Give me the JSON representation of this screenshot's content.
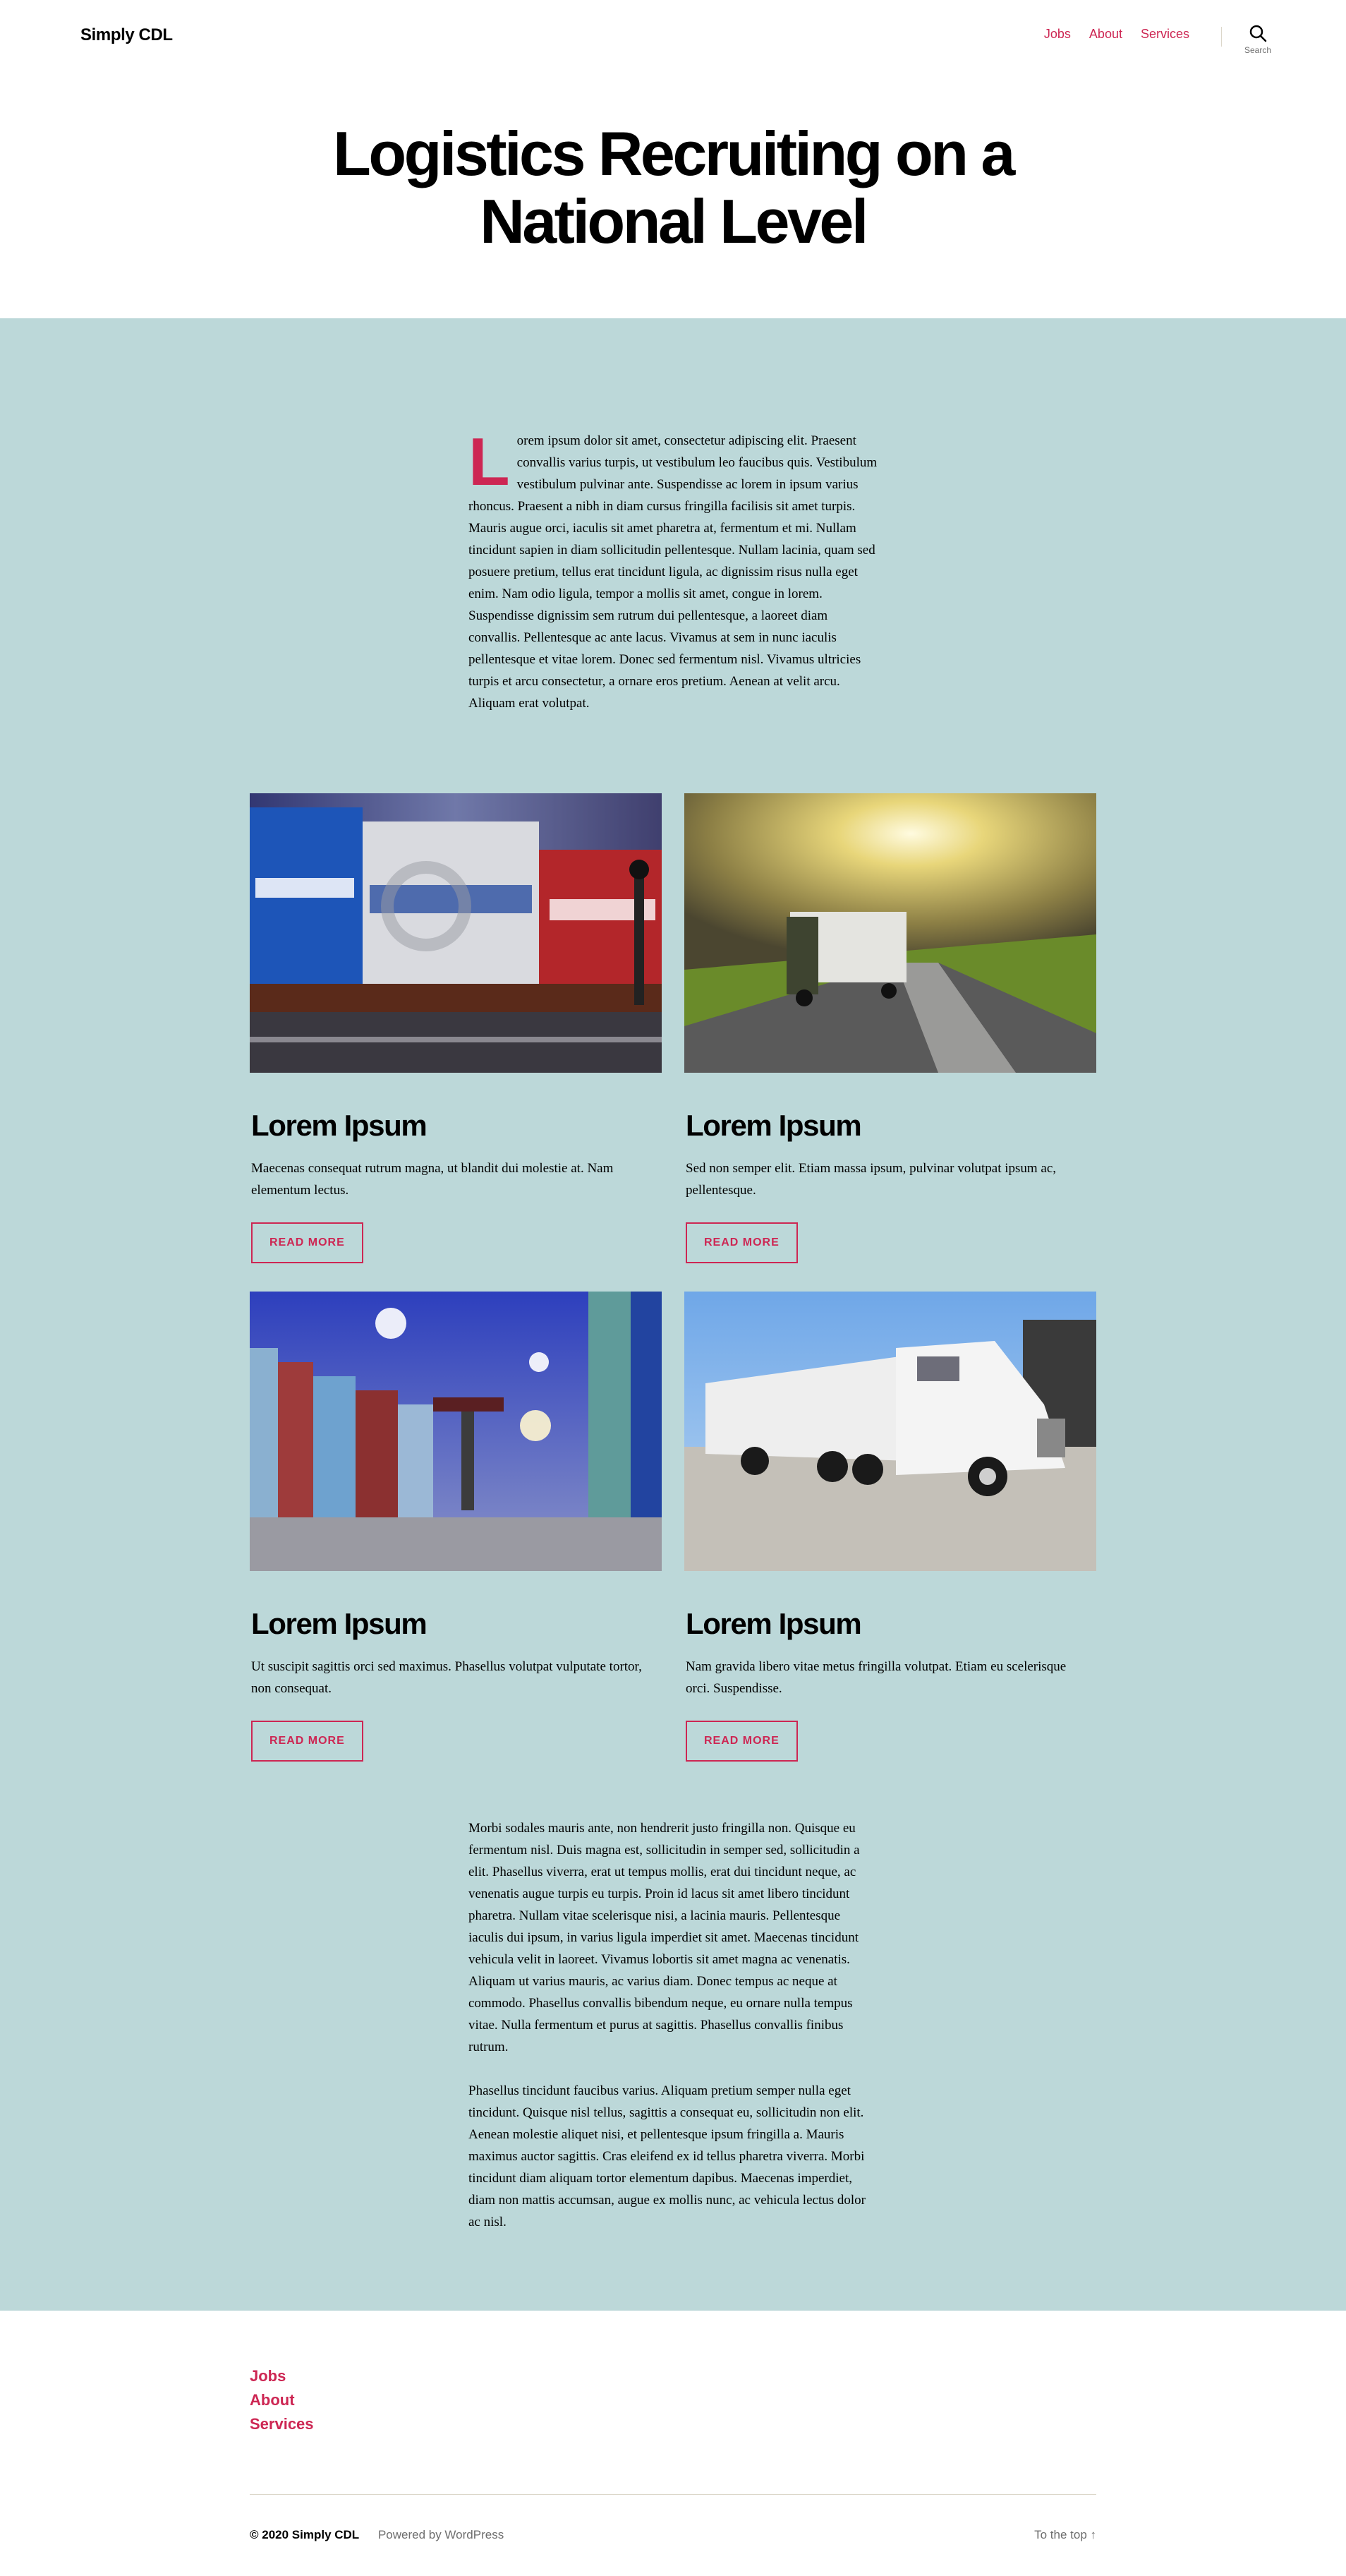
{
  "header": {
    "site_title": "Simply CDL",
    "nav": [
      {
        "label": "Jobs"
      },
      {
        "label": "About"
      },
      {
        "label": "Services"
      }
    ],
    "search_label": "Search",
    "search_icon": "search-icon"
  },
  "hero": {
    "title": "Logistics Recruiting on a National Level"
  },
  "intro": {
    "dropcap": "L",
    "text": "orem ipsum dolor sit amet, consectetur adipiscing elit. Praesent convallis varius turpis, ut vestibulum leo faucibus quis. Vestibulum vestibulum pulvinar ante. Suspendisse ac lorem in ipsum varius rhoncus. Praesent a nibh in diam cursus fringilla facilisis sit amet turpis. Mauris augue orci, iaculis sit amet pharetra at, fermentum et mi. Nullam tincidunt sapien in diam sollicitudin pellentesque. Nullam lacinia, quam sed posuere pretium, tellus erat tincidunt ligula, ac dignissim risus nulla eget enim. Nam odio ligula, tempor a mollis sit amet, congue in lorem. Suspendisse dignissim sem rutrum dui pellentesque, a laoreet diam convallis. Pellentesque ac ante lacus. Vivamus at sem in nunc iaculis pellentesque et vitae lorem. Donec sed fermentum nisl. Vivamus ultricies turpis et arcu consectetur, a ornare eros pretium. Aenean at velit arcu. Aliquam erat volutpat."
  },
  "cards": [
    {
      "title": "Lorem Ipsum",
      "text": "Maecenas consequat rutrum magna, ut blandit dui molestie at. Nam elementum lectus.",
      "button": "READ MORE"
    },
    {
      "title": "Lorem Ipsum",
      "text": "Sed non semper elit. Etiam massa ipsum, pulvinar volutpat ipsum ac, pellentesque.",
      "button": "READ MORE"
    },
    {
      "title": "Lorem Ipsum",
      "text": "Ut suscipit sagittis orci sed maximus. Phasellus volutpat vulputate tortor, non consequat.",
      "button": "READ MORE"
    },
    {
      "title": "Lorem Ipsum",
      "text": "Nam gravida libero vitae metus fringilla volutpat. Etiam eu scelerisque orci. Suspendisse.",
      "button": "READ MORE"
    }
  ],
  "outro": [
    "Morbi sodales mauris ante, non hendrerit justo fringilla non. Quisque eu fermentum nisl. Duis magna est, sollicitudin in semper sed, sollicitudin a elit. Phasellus viverra, erat ut tempus mollis, erat dui tincidunt neque, ac venenatis augue turpis eu turpis. Proin id lacus sit amet libero tincidunt pharetra. Nullam vitae scelerisque nisi, a lacinia mauris. Pellentesque iaculis dui ipsum, in varius ligula imperdiet sit amet. Maecenas tincidunt vehicula velit in laoreet. Vivamus lobortis sit amet magna ac venenatis. Aliquam ut varius mauris, ac varius diam. Donec tempus ac neque at commodo. Phasellus convallis bibendum neque, eu ornare nulla tempus vitae. Nulla fermentum et purus at sagittis. Phasellus convallis finibus rutrum.",
    "Phasellus tincidunt faucibus varius. Aliquam pretium semper nulla eget tincidunt. Quisque nisl tellus, sagittis a consequat eu, sollicitudin non elit. Aenean molestie aliquet nisi, et pellentesque ipsum fringilla a. Mauris maximus auctor sagittis. Cras eleifend ex id tellus pharetra viverra. Morbi tincidunt diam aliquam tortor elementum dapibus. Maecenas imperdiet, diam non mattis accumsan, augue ex mollis nunc, ac vehicula lectus dolor ac nisl."
  ],
  "footer": {
    "nav": [
      {
        "label": "Jobs"
      },
      {
        "label": "About"
      },
      {
        "label": "Services"
      }
    ],
    "copyright": "© 2020 Simply CDL",
    "powered": "Powered by WordPress",
    "to_top": "To the top ↑"
  },
  "colors": {
    "accent": "#cd2653",
    "band": "#bcd8d9",
    "text": "#000000",
    "muted": "#6d6d6d"
  }
}
